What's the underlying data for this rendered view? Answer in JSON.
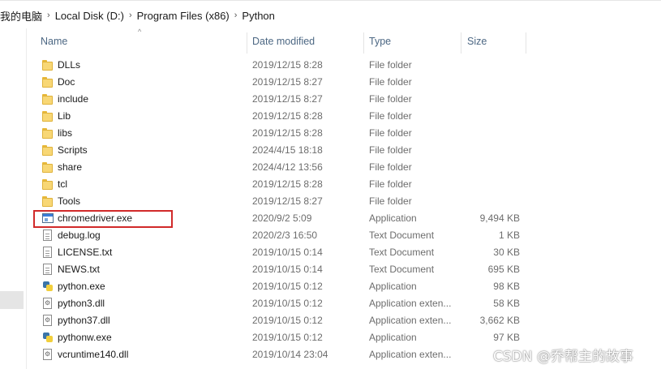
{
  "breadcrumb": [
    {
      "label": "我的电脑"
    },
    {
      "label": "Local Disk (D:)"
    },
    {
      "label": "Program Files (x86)"
    },
    {
      "label": "Python"
    }
  ],
  "columns": {
    "name": "Name",
    "date": "Date modified",
    "type": "Type",
    "size": "Size"
  },
  "files": [
    {
      "name": "DLLs",
      "date": "2019/12/15 8:28",
      "type": "File folder",
      "size": "",
      "icon": "folder-icon"
    },
    {
      "name": "Doc",
      "date": "2019/12/15 8:27",
      "type": "File folder",
      "size": "",
      "icon": "folder-icon"
    },
    {
      "name": "include",
      "date": "2019/12/15 8:27",
      "type": "File folder",
      "size": "",
      "icon": "folder-icon"
    },
    {
      "name": "Lib",
      "date": "2019/12/15 8:28",
      "type": "File folder",
      "size": "",
      "icon": "folder-icon"
    },
    {
      "name": "libs",
      "date": "2019/12/15 8:28",
      "type": "File folder",
      "size": "",
      "icon": "folder-icon"
    },
    {
      "name": "Scripts",
      "date": "2024/4/15 18:18",
      "type": "File folder",
      "size": "",
      "icon": "folder-icon"
    },
    {
      "name": "share",
      "date": "2024/4/12 13:56",
      "type": "File folder",
      "size": "",
      "icon": "folder-icon"
    },
    {
      "name": "tcl",
      "date": "2019/12/15 8:28",
      "type": "File folder",
      "size": "",
      "icon": "folder-icon"
    },
    {
      "name": "Tools",
      "date": "2019/12/15 8:27",
      "type": "File folder",
      "size": "",
      "icon": "folder-icon"
    },
    {
      "name": "chromedriver.exe",
      "date": "2020/9/2 5:09",
      "type": "Application",
      "size": "9,494 KB",
      "icon": "application-icon"
    },
    {
      "name": "debug.log",
      "date": "2020/2/3 16:50",
      "type": "Text Document",
      "size": "1 KB",
      "icon": "text-document-icon"
    },
    {
      "name": "LICENSE.txt",
      "date": "2019/10/15 0:14",
      "type": "Text Document",
      "size": "30 KB",
      "icon": "text-document-icon"
    },
    {
      "name": "NEWS.txt",
      "date": "2019/10/15 0:14",
      "type": "Text Document",
      "size": "695 KB",
      "icon": "text-document-icon"
    },
    {
      "name": "python.exe",
      "date": "2019/10/15 0:12",
      "type": "Application",
      "size": "98 KB",
      "icon": "python-icon"
    },
    {
      "name": "python3.dll",
      "date": "2019/10/15 0:12",
      "type": "Application exten...",
      "size": "58 KB",
      "icon": "dll-icon"
    },
    {
      "name": "python37.dll",
      "date": "2019/10/15 0:12",
      "type": "Application exten...",
      "size": "3,662 KB",
      "icon": "dll-icon"
    },
    {
      "name": "pythonw.exe",
      "date": "2019/10/15 0:12",
      "type": "Application",
      "size": "97 KB",
      "icon": "python-icon"
    },
    {
      "name": "vcruntime140.dll",
      "date": "2019/10/14 23:04",
      "type": "Application exten...",
      "size": "",
      "icon": "dll-icon"
    }
  ],
  "watermark": "CSDN @乔帮主的故事"
}
